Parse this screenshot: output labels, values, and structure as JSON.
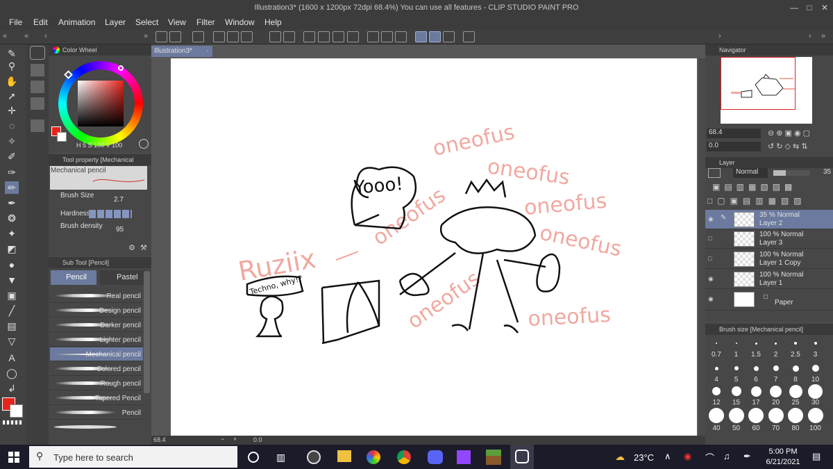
{
  "window": {
    "title": "Illustration3* (1600 x 1200px 72dpi 68.4%)  You can use all features - CLIP STUDIO PAINT PRO"
  },
  "menu": [
    "File",
    "Edit",
    "Animation",
    "Layer",
    "Select",
    "View",
    "Filter",
    "Window",
    "Help"
  ],
  "color_wheel": {
    "title": "Color Wheel",
    "h_value": "5",
    "s_value": "100",
    "v_value": "100",
    "main_color": "#e8231b",
    "sub_color": "#ffffff"
  },
  "tool_property": {
    "title": "Tool property [Mechanical",
    "preset_name": "Mechanical pencil",
    "brush_size_label": "Brush Size",
    "brush_size_value": "2.7",
    "hardness_label": "Hardness",
    "density_label": "Brush density",
    "density_value": "95"
  },
  "sub_tool": {
    "title": "Sub Tool [Pencil]",
    "tabs": [
      "Pencil",
      "Pastel"
    ],
    "items": [
      "Real pencil",
      "Design pencil",
      "Darker pencil",
      "Lighter pencil",
      "Mechanical pencil",
      "Colored pencil",
      "Rough pencil",
      "Tapered Pencil",
      "Pencil"
    ],
    "selected": "Mechanical pencil"
  },
  "canvas": {
    "tab": "Illustration3*",
    "zoom": "68.4",
    "angle": "0.0",
    "sketch_texts": {
      "yooo": "Yooo!",
      "ruziix": "Ruziix",
      "techno": "Techno, why!?",
      "oneofus": "oneofus"
    }
  },
  "navigator": {
    "title": "Navigator",
    "zoom": "68.4",
    "angle": "0.0"
  },
  "layer_panel": {
    "title": "Layer",
    "blend_mode": "Normal",
    "opacity": "35",
    "layers": [
      {
        "mode": "35 % Normal",
        "name": "Layer 2",
        "selected": true,
        "visible": true
      },
      {
        "mode": "100 % Normal",
        "name": "Layer 3",
        "selected": false,
        "visible": false
      },
      {
        "mode": "100 % Normal",
        "name": "Layer 1 Copy",
        "selected": false,
        "visible": false
      },
      {
        "mode": "100 % Normal",
        "name": "Layer 1",
        "selected": false,
        "visible": true
      }
    ],
    "paper": "Paper"
  },
  "brush_size": {
    "title": "Brush size [Mechanical pencil]",
    "sizes": [
      "0.7",
      "1",
      "1.5",
      "2",
      "2.5",
      "3",
      "4",
      "5",
      "6",
      "7",
      "8",
      "10",
      "12",
      "15",
      "17",
      "20",
      "25",
      "30",
      "40",
      "50",
      "60",
      "70",
      "80",
      "100"
    ]
  },
  "taskbar": {
    "search_placeholder": "Type here to search",
    "weather": "23°C",
    "time": "5:00 PM",
    "date": "6/21/2021"
  }
}
